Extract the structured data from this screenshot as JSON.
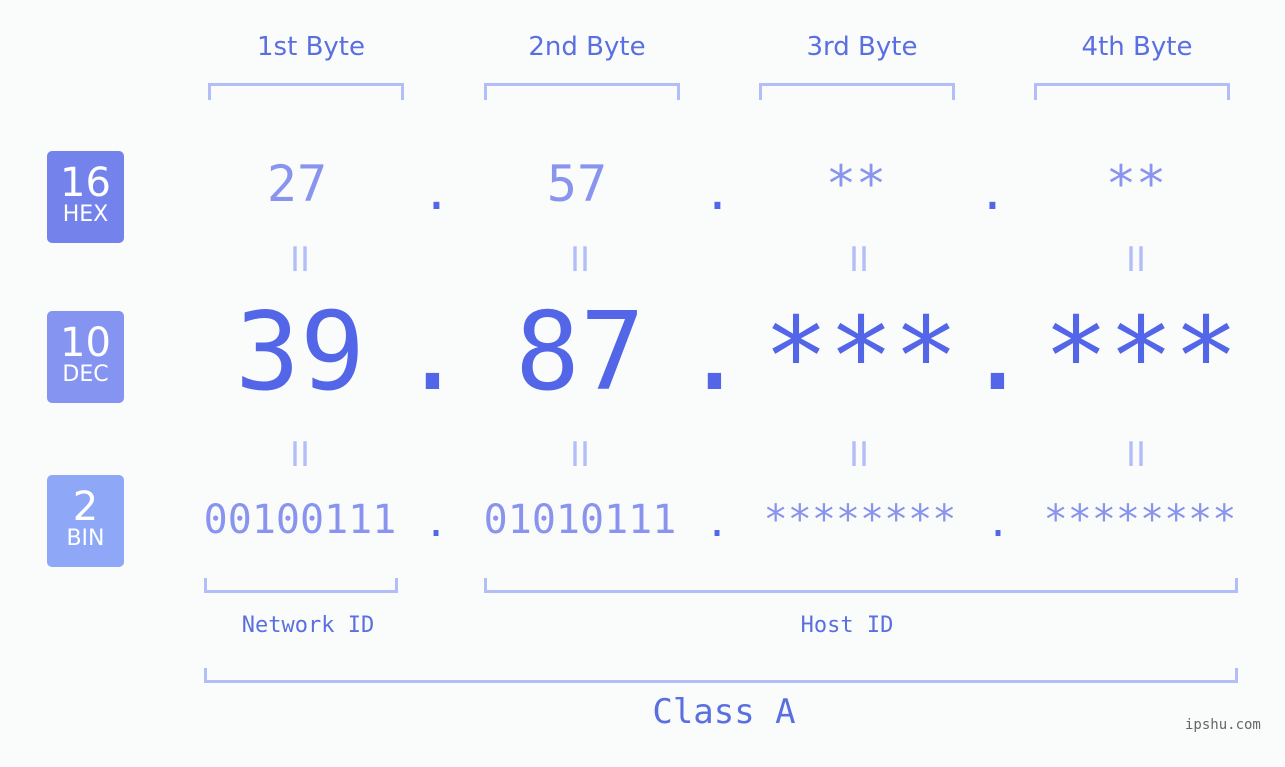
{
  "colors": {
    "hex_badge": "#7483ec",
    "dec_badge": "#8494f0",
    "bin_badge": "#8fa7f7",
    "accent": "#5366e8",
    "light": "#8894ee",
    "bracket": "#b3bdf7"
  },
  "badges": [
    {
      "number": "16",
      "label": "HEX"
    },
    {
      "number": "10",
      "label": "DEC"
    },
    {
      "number": "2",
      "label": "BIN"
    }
  ],
  "headers": [
    "1st Byte",
    "2nd Byte",
    "3rd Byte",
    "4th Byte"
  ],
  "hex": [
    "27",
    "57",
    "**",
    "**"
  ],
  "dec": [
    "39",
    "87",
    "***",
    "***"
  ],
  "bin": [
    "00100111",
    "01010111",
    "********",
    "********"
  ],
  "separator": ".",
  "equals": "II",
  "network_label": "Network ID",
  "host_label": "Host ID",
  "class_label": "Class A",
  "watermark": "ipshu.com"
}
